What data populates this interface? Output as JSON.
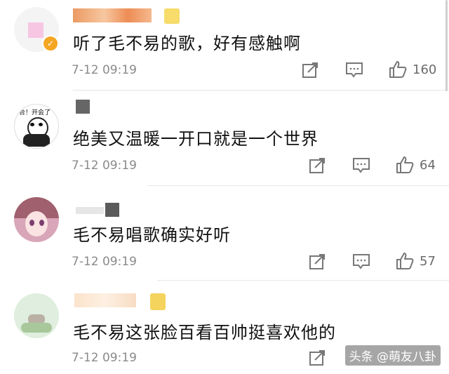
{
  "comments": [
    {
      "text": "听了毛不易的歌，好有感触啊",
      "time": "7-12 09:19",
      "likes": "160",
      "verified_badge": "✓"
    },
    {
      "avatar_caption": "合！开会了",
      "text": "绝美又温暖一开口就是一个世界",
      "time": "7-12 09:19",
      "likes": "64"
    },
    {
      "text": "毛不易唱歌确实好听",
      "time": "7-12 09:19",
      "likes": "57"
    },
    {
      "text": "毛不易这张脸百看百帅挺喜欢他的",
      "time": "7-12 09:19",
      "likes": ""
    }
  ],
  "icons": {
    "share": "share-icon",
    "comment": "comment-icon",
    "like": "thumbs-up-icon"
  },
  "watermark": "头条 @萌友八卦",
  "colors": {
    "accent_orange": "#f0b37e",
    "badge_yellow": "#f5d45e",
    "text_gray": "#8a8a8a"
  }
}
